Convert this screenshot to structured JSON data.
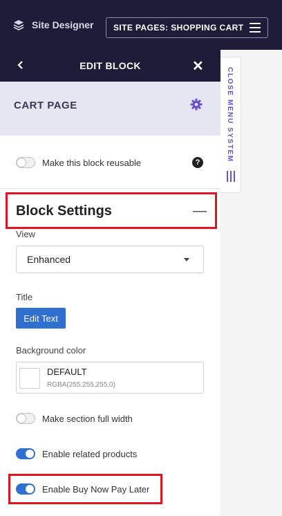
{
  "app": {
    "name": "Site Designer"
  },
  "site_pages": {
    "label": "SITE PAGES: SHOPPING CART"
  },
  "panel": {
    "header_title": "EDIT BLOCK"
  },
  "block": {
    "name": "CART PAGE"
  },
  "reusable": {
    "label": "Make this block reusable",
    "enabled": false
  },
  "block_settings": {
    "title": "Block Settings"
  },
  "view": {
    "label": "View",
    "selected": "Enhanced"
  },
  "title_field": {
    "label": "Title",
    "button": "Edit Text"
  },
  "background": {
    "label": "Background color",
    "name": "DEFAULT",
    "value": "RGBA(255,255,255,0)"
  },
  "full_width": {
    "label": "Make section full width",
    "enabled": false
  },
  "related_products": {
    "label": "Enable related products",
    "enabled": true
  },
  "bnpl": {
    "label": "Enable Buy Now Pay Later",
    "enabled": true
  },
  "side_tab": {
    "label": "CLOSE MENU SYSTEM"
  },
  "icons": [
    "layers-icon",
    "hamburger-icon",
    "chevron-left-icon",
    "close-icon",
    "gear-icon",
    "help-icon",
    "caret-down-icon",
    "vertical-bars-icon"
  ],
  "colors": {
    "topbar": "#1f1c3a",
    "accent": "#2f6fcf",
    "purple": "#6b4fcf",
    "highlight": "#e0141e",
    "cart_header_bg": "#e6e5f2"
  }
}
